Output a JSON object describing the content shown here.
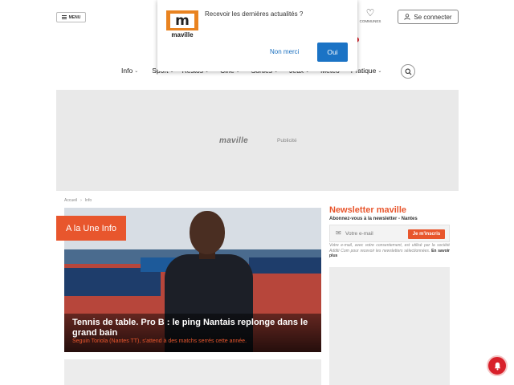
{
  "header": {
    "menu_label": "MENU",
    "communes_label": "COMMUNES",
    "login_label": "Se connecter"
  },
  "popup": {
    "logo_letter": "m",
    "logo_word": "maville",
    "message": "Recevoir les dernières actualités ?",
    "decline_label": "Non merci",
    "accept_label": "Oui"
  },
  "nav": {
    "items": [
      {
        "label": "Info",
        "has_dropdown": true
      },
      {
        "label": "Sport",
        "has_dropdown": true
      },
      {
        "label": "Restos",
        "has_dropdown": true
      },
      {
        "label": "Ciné",
        "has_dropdown": true
      },
      {
        "label": "Sorties",
        "has_dropdown": true
      },
      {
        "label": "Jeux",
        "has_dropdown": true
      },
      {
        "label": "Météo",
        "has_dropdown": false
      },
      {
        "label": "Pratique",
        "has_dropdown": true
      }
    ]
  },
  "ad": {
    "brand": "maville",
    "label": "Publicité"
  },
  "breadcrumb": {
    "home": "Accueil",
    "separator": "›",
    "current": "Info"
  },
  "hero": {
    "tag": "A la Une Info",
    "headline": "Tennis de table. Pro B : le ping Nantais replonge dans le grand bain",
    "subtitle": "Seguin Toriola (Nantes TT), s'attend à des matchs serrés cette année."
  },
  "newsletter": {
    "title": "Newsletter maville",
    "subtitle": "Abonnez-vous à la newsletter - Nantes",
    "email_placeholder": "Votre e-mail",
    "submit_label": "Je m'inscris",
    "legal": "Votre e-mail, avec votre consentement, est utilisé par la société Additi Com pour recevoir les newsletters sélectionnées.",
    "more_label": "En savoir plus"
  },
  "colors": {
    "accent": "#e8562d",
    "brand_orange": "#e98320",
    "button_blue": "#1b73c5",
    "notification_red": "#d8202a"
  }
}
